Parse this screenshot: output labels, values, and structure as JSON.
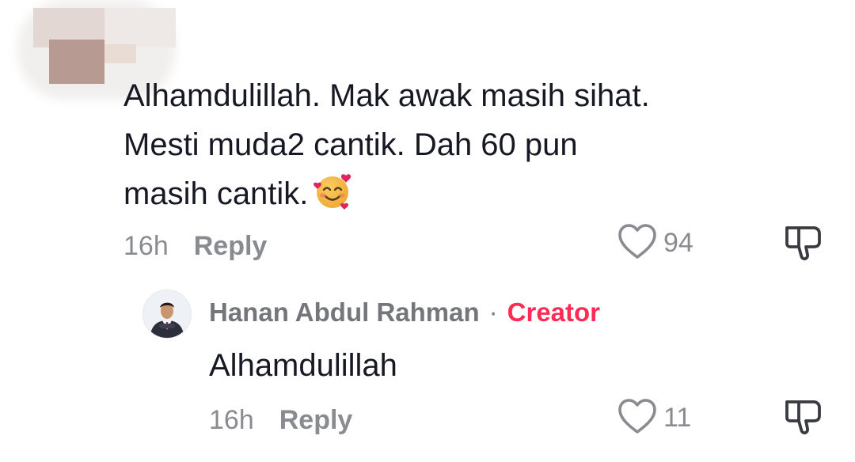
{
  "comment": {
    "lines": [
      "Alhamdulillah. Mak awak masih sihat.",
      "Mesti muda2 cantik. Dah 60 pun",
      "masih cantik."
    ],
    "emoji_icon": "smiling-face-with-hearts-icon",
    "time": "16h",
    "reply_label": "Reply",
    "like_count": "94"
  },
  "reply": {
    "author": "Hanan Abdul Rahman",
    "separator": "·",
    "badge": "Creator",
    "text": "Alhamdulillah",
    "time": "16h",
    "reply_label": "Reply",
    "like_count": "11"
  },
  "icons": {
    "like": "heart-outline-icon",
    "dislike": "thumbs-down-icon"
  },
  "colors": {
    "text": "#161823",
    "muted": "#8a8b91",
    "creator": "#fe2c55"
  }
}
